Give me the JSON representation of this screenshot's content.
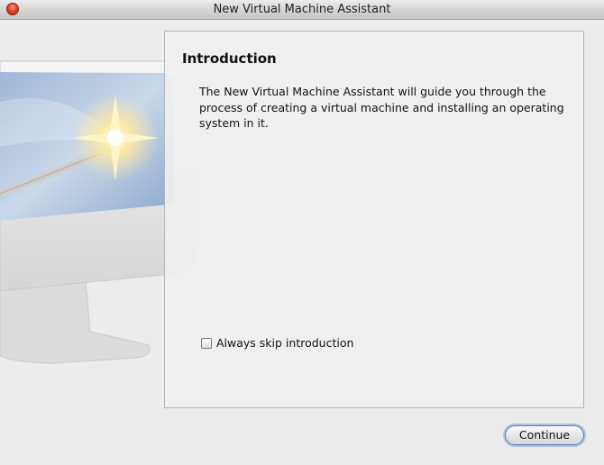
{
  "window": {
    "title": "New Virtual Machine Assistant"
  },
  "intro": {
    "heading": "Introduction",
    "body": "The New Virtual Machine Assistant will guide you through the process of creating a virtual machine and installing an operating system in it."
  },
  "skip_option": {
    "label": "Always skip introduction",
    "checked": false
  },
  "buttons": {
    "continue_label": "Continue"
  },
  "icons": {
    "close": "close-icon",
    "background": "computer-magic-wand-art"
  }
}
